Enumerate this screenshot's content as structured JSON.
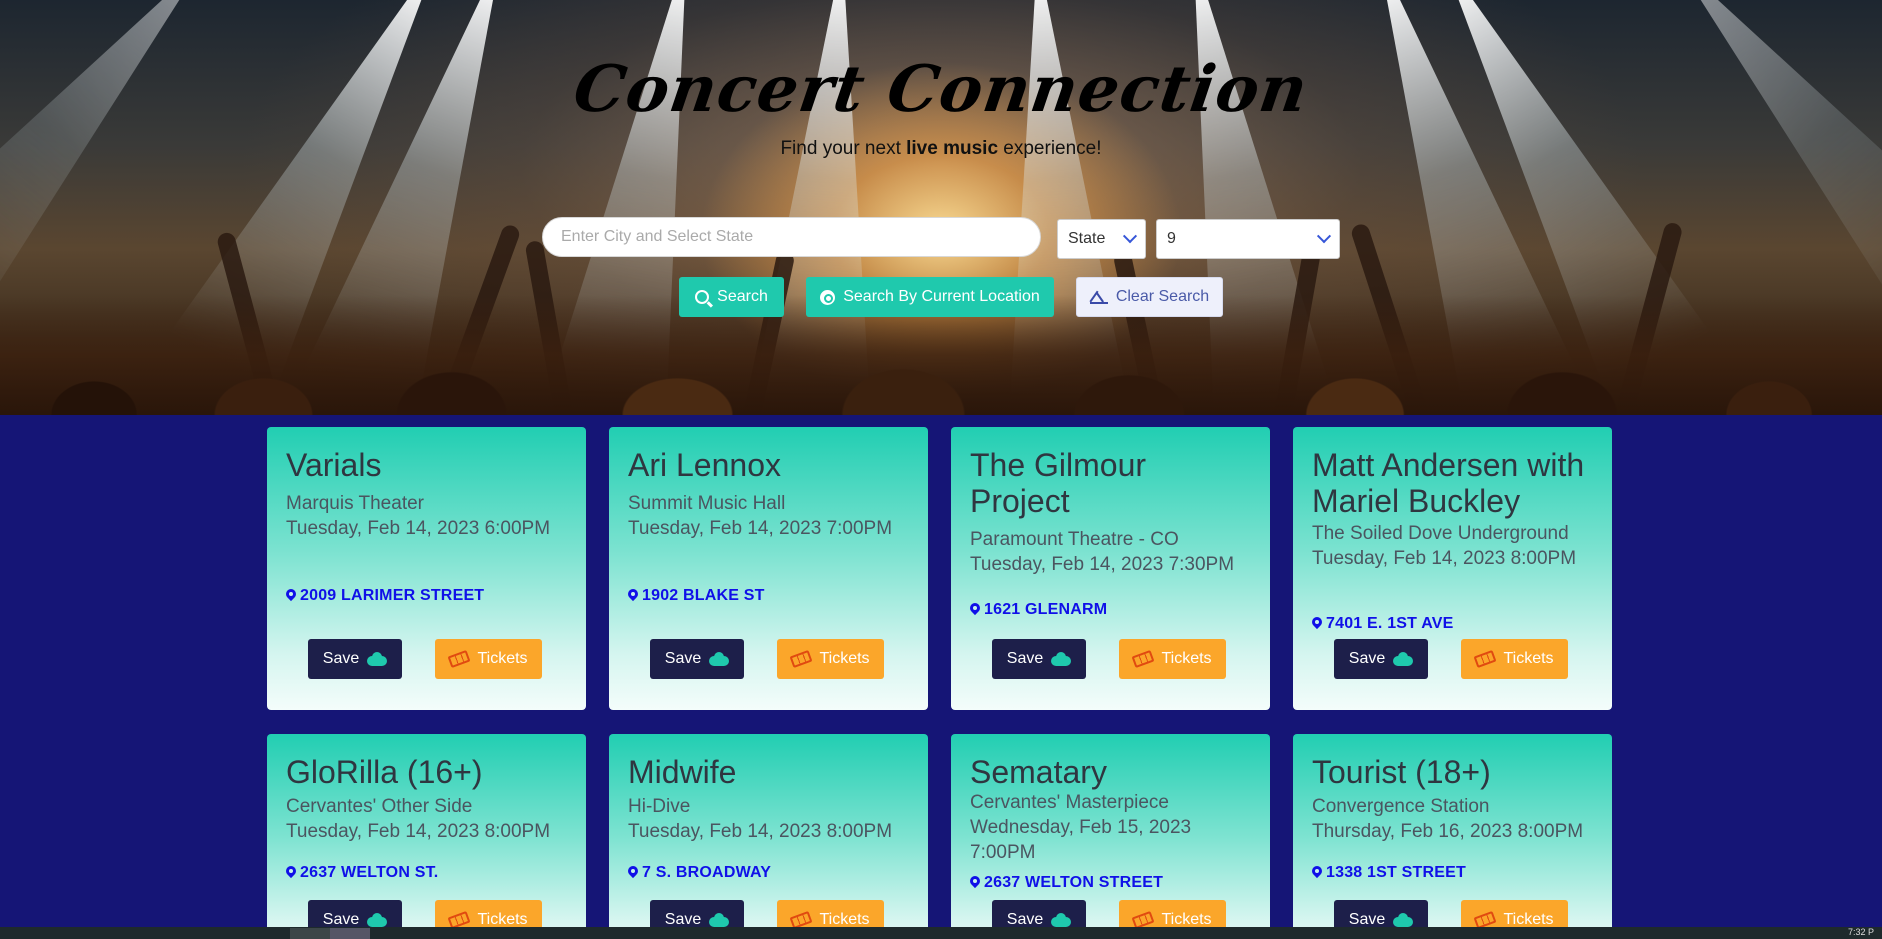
{
  "header": {
    "title": "Concert Connection",
    "subtitle_pre": "Find your next ",
    "subtitle_bold": "live music",
    "subtitle_post": " experience!"
  },
  "search": {
    "placeholder": "Enter City and Select State",
    "value": "",
    "state_select": "State",
    "radius_select": "9",
    "search_label": "Search",
    "location_label": "Search By Current Location",
    "clear_label": "Clear Search"
  },
  "colors": {
    "accent_teal": "#1fc9ad",
    "save_navy": "#1d1f4a",
    "tickets_orange": "#fba62a",
    "address_blue": "#1010e8",
    "page_background": "#151576"
  },
  "card_actions": {
    "save_label": "Save",
    "tickets_label": "Tickets"
  },
  "events": [
    {
      "artist": "Varials",
      "venue": "Marquis Theater",
      "date": "Tuesday, Feb 14, 2023 6:00PM",
      "address": "2009 LARIMER STREET"
    },
    {
      "artist": "Ari Lennox",
      "venue": "Summit Music Hall",
      "date": "Tuesday, Feb 14, 2023 7:00PM",
      "address": "1902 BLAKE ST"
    },
    {
      "artist": "The Gilmour Project",
      "venue": "Paramount Theatre - CO",
      "date": "Tuesday, Feb 14, 2023 7:30PM",
      "address": "1621 GLENARM"
    },
    {
      "artist": "Matt Andersen with Mariel Buckley",
      "venue": "The Soiled Dove Underground",
      "date": "Tuesday, Feb 14, 2023 8:00PM",
      "address": "7401 E. 1ST AVE"
    },
    {
      "artist": "GloRilla (16+)",
      "venue": "Cervantes' Other Side",
      "date": "Tuesday, Feb 14, 2023 8:00PM",
      "address": "2637 WELTON ST."
    },
    {
      "artist": "Midwife",
      "venue": "Hi-Dive",
      "date": "Tuesday, Feb 14, 2023 8:00PM",
      "address": "7 S. BROADWAY"
    },
    {
      "artist": "Sematary",
      "venue": "Cervantes' Masterpiece",
      "date": "Wednesday, Feb 15, 2023 7:00PM",
      "address": "2637 WELTON STREET"
    },
    {
      "artist": "Tourist (18+)",
      "venue": "Convergence Station",
      "date": "Thursday, Feb 16, 2023 8:00PM",
      "address": "1338 1ST STREET"
    }
  ],
  "taskbar": {
    "clock": "7:32 P"
  }
}
